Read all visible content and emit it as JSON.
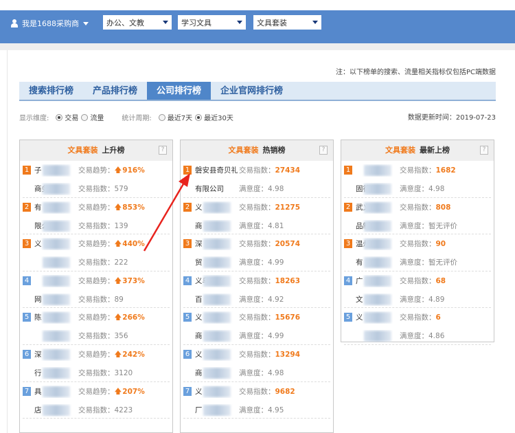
{
  "header": {
    "user_label": "我是1688采购商",
    "selects": [
      "办公、文教",
      "学习文具",
      "文具套装"
    ]
  },
  "note": "注：以下榜单的搜索、流量相关指标仅包括PC端数据",
  "tabs": [
    {
      "label": "搜索排行榜"
    },
    {
      "label": "产品排行榜"
    },
    {
      "label": "公司排行榜",
      "active": true
    },
    {
      "label": "企业官网排行榜"
    }
  ],
  "filters": {
    "dimension_label": "显示维度:",
    "dimension_options": [
      "交易",
      "流量"
    ],
    "dimension_selected": "交易",
    "period_label": "统计周期:",
    "period_options": [
      "最近7天",
      "最近30天"
    ],
    "period_selected": "最近30天"
  },
  "updated": "数据更新时间：2019-07-23",
  "accent": "#f07a1c",
  "brand": "#5588cc",
  "boards": [
    {
      "category": "文具套装",
      "title": "上升榜",
      "help": "?",
      "label1": "交易趋势：",
      "label2": "交易指数：",
      "rows": [
        {
          "rank": "1",
          "name1": "子",
          "name2": "商务",
          "v1": "916%",
          "v2": "579"
        },
        {
          "rank": "2",
          "name1": "有",
          "name2": "限么",
          "v1": "853%",
          "v2": "139"
        },
        {
          "rank": "3",
          "name1": "义",
          "name2": "",
          "v1": "440%",
          "v2": "222"
        },
        {
          "rank": "4",
          "name1": "",
          "name2": "网",
          "v1": "373%",
          "v2": "89"
        },
        {
          "rank": "5",
          "name1": "陈",
          "name2": "",
          "v1": "266%",
          "v2": "356"
        },
        {
          "rank": "6",
          "name1": "深",
          "name2": "行",
          "v1": "242%",
          "v2": "3120"
        },
        {
          "rank": "7",
          "name1": "具",
          "name2": "店",
          "v1": "207%",
          "v2": "4223"
        }
      ]
    },
    {
      "category": "文具套装",
      "title": "热销榜",
      "help": "?",
      "label1": "交易指数：",
      "label2": "满意度：",
      "rows": [
        {
          "rank": "1",
          "name1": "磐安县奇贝礼品",
          "name2": "有限公司",
          "v1": "27434",
          "v2": "4.98"
        },
        {
          "rank": "2",
          "name1": "义",
          "name2": "商",
          "v1": "21275",
          "v2": "4.81"
        },
        {
          "rank": "3",
          "name1": "深",
          "name2": "贸",
          "v1": "20574",
          "v2": "4.99"
        },
        {
          "rank": "4",
          "name1": "义乌",
          "name2": "百",
          "v1": "18263",
          "v2": "4.92"
        },
        {
          "rank": "5",
          "name1": "义",
          "name2": "商",
          "v1": "15676",
          "v2": "4.99"
        },
        {
          "rank": "6",
          "name1": "义",
          "name2": "商",
          "v1": "13294",
          "v2": "4.98"
        },
        {
          "rank": "7",
          "name1": "义",
          "name2": "厂",
          "v1": "9682",
          "v2": "4.95"
        }
      ]
    },
    {
      "category": "文具套装",
      "title": "最新上榜",
      "help": "?",
      "label1": "交易指数：",
      "label2": "满意度：",
      "rows": [
        {
          "rank": "1",
          "name1": "",
          "name2": "固德",
          "v1": "1682",
          "v2": "4.98"
        },
        {
          "rank": "2",
          "name1": "武义",
          "name2": "品制",
          "v1": "808",
          "v2": "暂无评价"
        },
        {
          "rank": "3",
          "name1": "温州",
          "name2": "有",
          "v1": "90",
          "v2": "暂无评价"
        },
        {
          "rank": "4",
          "name1": "广",
          "name2": "文",
          "v1": "68",
          "v2": "4.89"
        },
        {
          "rank": "5",
          "name1": "义",
          "name2": "",
          "v1": "6",
          "v2": "4.86"
        }
      ]
    }
  ]
}
